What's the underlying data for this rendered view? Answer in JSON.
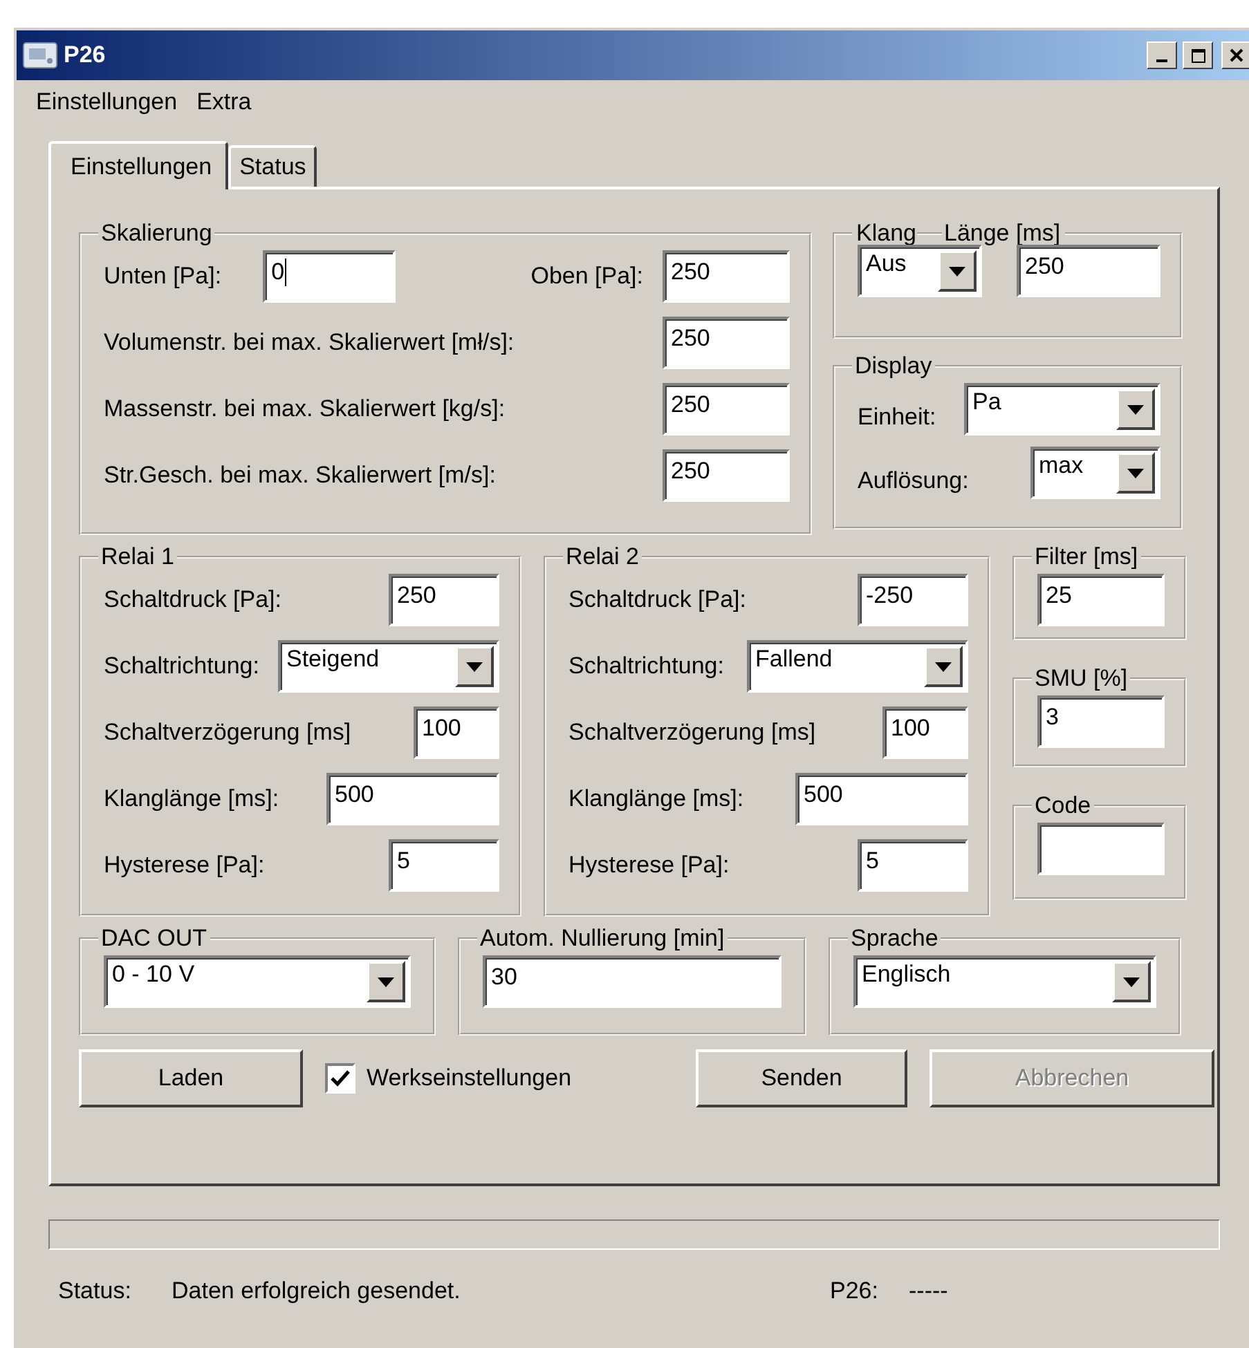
{
  "window": {
    "title": "P26"
  },
  "menu": [
    {
      "label": "Einstellungen"
    },
    {
      "label": "Extra"
    }
  ],
  "tabs": [
    {
      "label": "Einstellungen",
      "selected": true
    },
    {
      "label": "Status",
      "selected": false
    }
  ],
  "skalierung": {
    "title": "Skalierung",
    "rows": [
      {
        "fields": [
          {
            "label": "Unten [Pa]:",
            "value": "0",
            "focused": true
          },
          {
            "label": "Oben [Pa]:",
            "value": "250"
          }
        ]
      },
      {
        "fields": [
          {
            "label": "Volumenstr. bei max. Skalierwert [mł/s]:",
            "value": "250"
          }
        ]
      },
      {
        "fields": [
          {
            "label": "Massenstr. bei max. Skalierwert [kg/s]:",
            "value": "250"
          }
        ]
      },
      {
        "fields": [
          {
            "label": "Str.Gesch. bei max. Skalierwert [m/s]:",
            "value": "250"
          }
        ]
      }
    ]
  },
  "klang": {
    "title": "Klang",
    "value": "Aus"
  },
  "laenge": {
    "title": "Länge [ms]",
    "value": "250"
  },
  "display": {
    "title": "Display",
    "rows": [
      {
        "label": "Einheit:",
        "value": "Pa"
      },
      {
        "label": "Auflösung:",
        "value": "max"
      }
    ]
  },
  "relays": [
    {
      "title": "Relai 1",
      "rows": [
        {
          "label": "Schaltdruck [Pa]:",
          "kind": "input",
          "value": "250"
        },
        {
          "label": "Schaltrichtung:",
          "kind": "select",
          "value": "Steigend"
        },
        {
          "label": "Schaltverzögerung [ms]",
          "kind": "input",
          "value": "100"
        },
        {
          "label": "Klanglänge [ms]:",
          "kind": "input",
          "value": "500"
        },
        {
          "label": "Hysterese [Pa]:",
          "kind": "input",
          "value": "5"
        }
      ]
    },
    {
      "title": "Relai 2",
      "rows": [
        {
          "label": "Schaltdruck [Pa]:",
          "kind": "input",
          "value": "-250"
        },
        {
          "label": "Schaltrichtung:",
          "kind": "select",
          "value": "Fallend"
        },
        {
          "label": "Schaltverzögerung [ms]",
          "kind": "input",
          "value": "100"
        },
        {
          "label": "Klanglänge [ms]:",
          "kind": "input",
          "value": "500"
        },
        {
          "label": "Hysterese [Pa]:",
          "kind": "input",
          "value": "5"
        }
      ]
    }
  ],
  "small_groups": [
    {
      "title": "Filter [ms]",
      "value": "25"
    },
    {
      "title": "SMU [%]",
      "value": "3"
    },
    {
      "title": "Code"
    }
  ],
  "bottom_groups": [
    {
      "title": "DAC OUT",
      "kind": "select",
      "value": "0 - 10 V"
    },
    {
      "title": "Autom. Nullierung [min]",
      "kind": "input",
      "value": "30"
    },
    {
      "title": "Sprache",
      "kind": "select",
      "value": "Englisch"
    }
  ],
  "actions": [
    {
      "kind": "button",
      "label": "Laden",
      "disabled": false
    },
    {
      "kind": "checkbox",
      "label": "Werkseinstellungen",
      "checked": true
    },
    {
      "kind": "button",
      "label": "Senden",
      "disabled": false
    },
    {
      "kind": "button",
      "label": "Abbrechen",
      "disabled": true
    }
  ],
  "progress": {
    "level": 0
  },
  "status_bar": {
    "label": "Status:",
    "message": "Daten erfolgreich gesendet.",
    "device_label": "P26:",
    "device_value": "-----"
  }
}
